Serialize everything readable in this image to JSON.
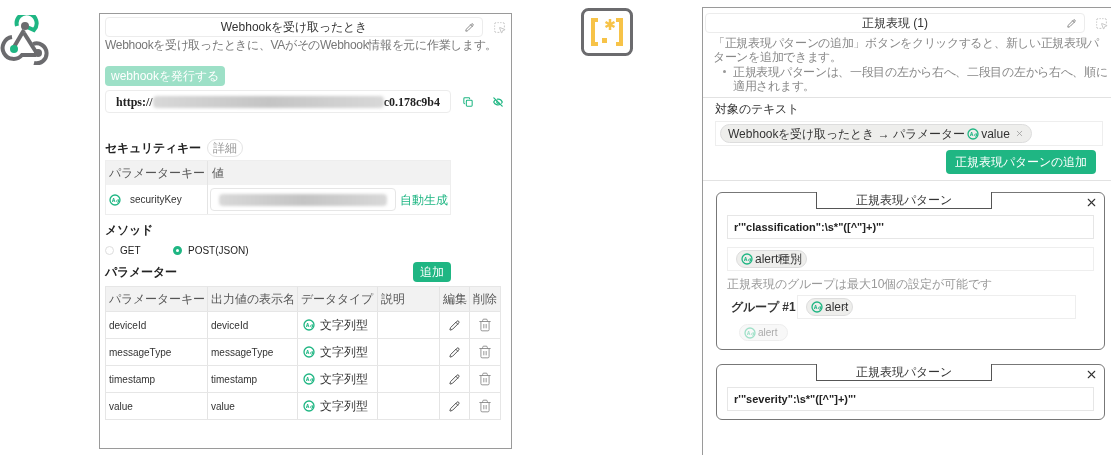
{
  "webhook_node": {
    "title": "Webhookを受け取ったとき",
    "description": "Webhookを受け取ったときに、VAがそのWebhook情報を元に作業します。",
    "issue_button": {
      "label": "webhookを発行する",
      "disabled": true
    },
    "url": {
      "prefix": "https://",
      "suffix": "c0.178c9b4"
    },
    "security": {
      "heading": "セキュリティキー",
      "detail_badge": "詳細",
      "columns": [
        "パラメーターキー",
        "値"
      ],
      "key": "securityKey",
      "generate_link": "自動生成"
    },
    "method": {
      "heading": "メソッド",
      "options": [
        {
          "label": "GET",
          "selected": false
        },
        {
          "label": "POST(JSON)",
          "selected": true
        }
      ]
    },
    "parameters": {
      "heading": "パラメーター",
      "add_button": "追加",
      "columns": [
        "パラメーターキー",
        "出力値の表示名",
        "データタイプ",
        "説明",
        "編集",
        "削除"
      ],
      "rows": [
        {
          "key": "deviceId",
          "display_name": "deviceId",
          "data_type": "文字列型"
        },
        {
          "key": "messageType",
          "display_name": "messageType",
          "data_type": "文字列型"
        },
        {
          "key": "timestamp",
          "display_name": "timestamp",
          "data_type": "文字列型"
        },
        {
          "key": "value",
          "display_name": "value",
          "data_type": "文字列型"
        }
      ]
    }
  },
  "regex_node": {
    "title": "正規表現 (1)",
    "instruction": "「正規表現パターンの追加」ボタンをクリックすると、新しい正規表現パターンを追加できます。",
    "bullets": [
      "正規表現パターンは、一段目の左から右へ、二段目の左から右へ、順に適用されます。"
    ],
    "target_label": "対象のテキスト",
    "target_chip": {
      "source": "Webhookを受け取ったとき → パラメーター",
      "value": "value"
    },
    "add_button": "正規表現パターンの追加",
    "patterns": [
      {
        "title": "正規表現パターン",
        "expression": "r'\"classification\":\\s*\"([^\"]+)\"'",
        "output_chip": "alert種別",
        "group_note": "正規表現のグループは最大10個の設定が可能です",
        "groups": [
          {
            "label": "グループ #1",
            "chip": "alert"
          }
        ],
        "suggestions": [
          {
            "label": "alert",
            "dimmed": true
          }
        ]
      },
      {
        "title": "正規表現パターン",
        "expression": "r'\"severity\":\\s*\"([^\"]+)\"'"
      }
    ]
  }
}
